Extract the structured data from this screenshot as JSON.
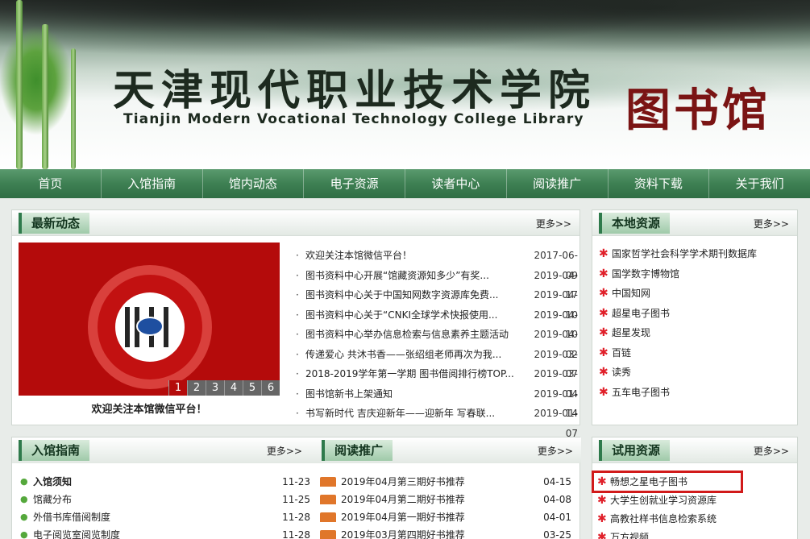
{
  "banner": {
    "title_cn": "天津现代职业技术学院",
    "title_en": "Tianjin Modern Vocational Technology College Library",
    "title_lib": "图书馆"
  },
  "nav": [
    "首页",
    "入馆指南",
    "馆内动态",
    "电子资源",
    "读者中心",
    "阅读推广",
    "资料下载",
    "关于我们"
  ],
  "latest": {
    "title": "最新动态",
    "more": "更多>>",
    "caption": "欢迎关注本馆微信平台！",
    "pager": [
      "1",
      "2",
      "3",
      "4",
      "5",
      "6"
    ],
    "items": [
      {
        "title": "欢迎关注本馆微信平台！",
        "date": "2017-06-09"
      },
      {
        "title": "图书资料中心开展“馆藏资源知多少”有奖...",
        "date": "2019-04-17"
      },
      {
        "title": "图书资料中心关于中国知网数字资源库免费...",
        "date": "2019-04-10"
      },
      {
        "title": "图书资料中心关于“CNKI全球学术快报使用...",
        "date": "2019-04-10"
      },
      {
        "title": "图书资料中心举办信息检索与信息素养主题活动",
        "date": "2019-04-02"
      },
      {
        "title": "传递爱心 共沐书香——张绍组老师再次为我...",
        "date": "2019-03-07"
      },
      {
        "title": "2018-2019学年第一学期 图书借阅排行榜TOP...",
        "date": "2019-03-04"
      },
      {
        "title": "图书馆新书上架通知",
        "date": "2019-01-14"
      },
      {
        "title": "书写新时代 吉庆迎新年——迎新年 写春联...",
        "date": "2019-01-07"
      }
    ]
  },
  "local": {
    "title": "本地资源",
    "more": "更多>>",
    "items": [
      "国家哲学社会科学学术期刊数据库",
      "国学数字博物馆",
      "中国知网",
      "超星电子图书",
      "超星发现",
      "百链",
      "读秀",
      "五车电子图书"
    ]
  },
  "guide": {
    "title": "入馆指南",
    "more": "更多>>",
    "items": [
      {
        "title": "入馆须知",
        "date": "11-23"
      },
      {
        "title": "馆藏分布",
        "date": "11-25"
      },
      {
        "title": "外借书库借阅制度",
        "date": "11-28"
      },
      {
        "title": "电子阅览室阅览制度",
        "date": "11-28"
      }
    ]
  },
  "reading": {
    "title": "阅读推广",
    "more": "更多>>",
    "items": [
      {
        "title": "2019年04月第三期好书推荐",
        "date": "04-15"
      },
      {
        "title": "2019年04月第二期好书推荐",
        "date": "04-08"
      },
      {
        "title": "2019年04月第一期好书推荐",
        "date": "04-01"
      },
      {
        "title": "2019年03月第四期好书推荐",
        "date": "03-25"
      }
    ]
  },
  "trial": {
    "title": "试用资源",
    "more": "更多>>",
    "items": [
      "畅想之星电子图书",
      "大学生创就业学习资源库",
      "高教社样书信息检索系统",
      "万方视频"
    ]
  },
  "colors": {
    "nav": "#3e8053",
    "accent_red": "#b40b0b",
    "highlight": "#d11a1a"
  }
}
